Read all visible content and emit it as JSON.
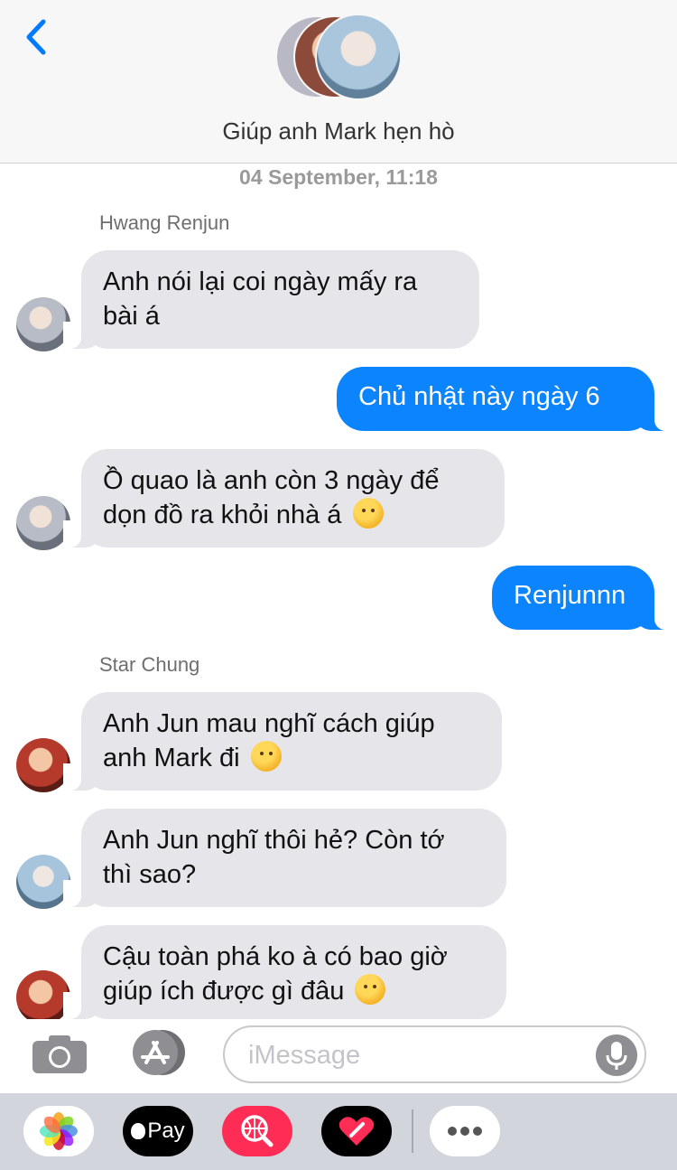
{
  "header": {
    "title": "Giúp anh Mark hẹn hò"
  },
  "timestamp": "04 September, 11:18",
  "messages": [
    {
      "sender": "Hwang Renjun",
      "line1": "Anh nói lại coi ngày mấy ra",
      "line2": "bài á"
    },
    {
      "text": "Chủ nhật này ngày 6"
    },
    {
      "line1": "Ồ quao là anh còn 3 ngày để",
      "line2": "dọn đồ ra khỏi nhà á"
    },
    {
      "text": "Renjunnn"
    },
    {
      "sender": "Star Chung",
      "line1": "Anh Jun mau nghĩ cách giúp",
      "line2": "anh Mark đi"
    },
    {
      "line1": "Anh Jun nghĩ thôi hẻ? Còn tớ",
      "line2": "thì sao?"
    },
    {
      "line1": "Cậu toàn phá ko à có bao giờ",
      "line2": "giúp ích được gì đâu"
    }
  ],
  "input": {
    "placeholder": "iMessage"
  },
  "apps": {
    "apple_pay_label": "Pay"
  },
  "icons": {
    "back": "chevron-left-icon",
    "camera": "camera-icon",
    "appstore": "app-store-icon",
    "mic": "microphone-icon",
    "photos": "photos-icon",
    "search": "web-search-icon",
    "heart": "digital-touch-icon",
    "more": "more-icon"
  },
  "colors": {
    "outgoing": "#0b84fe",
    "incoming": "#e5e5ea",
    "accent": "#007aff"
  }
}
